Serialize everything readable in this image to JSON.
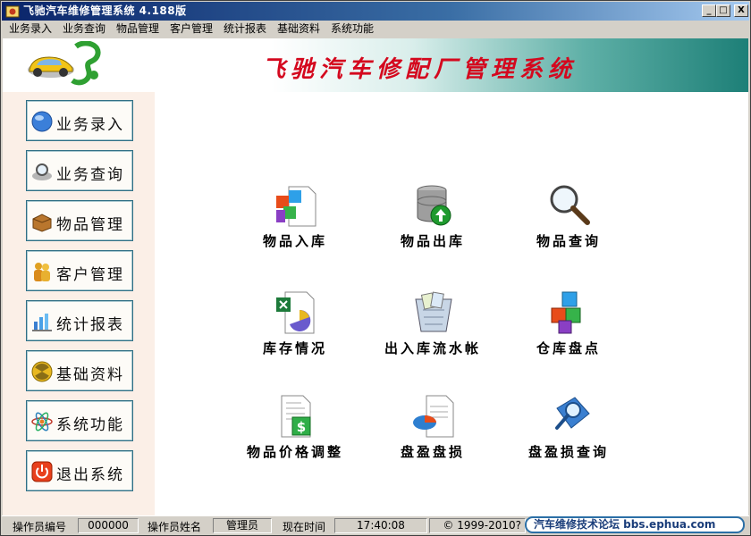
{
  "window": {
    "title": "飞驰汽车维修管理系统 4.188版",
    "controls": {
      "minimize": "_",
      "maximize": "□",
      "close": "X"
    }
  },
  "menu": [
    "业务录入",
    "业务查询",
    "物品管理",
    "客户管理",
    "统计报表",
    "基础资料",
    "系统功能"
  ],
  "banner": {
    "title": "飞驰汽车修配厂管理系统",
    "logo_icon": "car-logo"
  },
  "sidebar": [
    {
      "label": "业务录入",
      "icon": "globe-icon"
    },
    {
      "label": "业务查询",
      "icon": "magnifier-icon"
    },
    {
      "label": "物品管理",
      "icon": "box-icon"
    },
    {
      "label": "客户管理",
      "icon": "people-icon"
    },
    {
      "label": "统计报表",
      "icon": "bar-chart-icon"
    },
    {
      "label": "基础资料",
      "icon": "radiation-icon"
    },
    {
      "label": "系统功能",
      "icon": "atom-icon"
    },
    {
      "label": "退出系统",
      "icon": "power-icon"
    }
  ],
  "tiles": [
    {
      "label": "物品入库",
      "icon": "cubes-document-icon"
    },
    {
      "label": "物品出库",
      "icon": "database-upload-icon"
    },
    {
      "label": "物品查询",
      "icon": "magnifier-icon"
    },
    {
      "label": "库存情况",
      "icon": "excel-chart-icon"
    },
    {
      "label": "出入库流水帐",
      "icon": "recycle-bin-icon"
    },
    {
      "label": "仓库盘点",
      "icon": "cubes-icon"
    },
    {
      "label": "物品价格调整",
      "icon": "price-document-icon"
    },
    {
      "label": "盘盈盘损",
      "icon": "pie-document-icon"
    },
    {
      "label": "盘盈损查询",
      "icon": "search-document-icon"
    }
  ],
  "status": {
    "operator_id_label": "操作员编号",
    "operator_id": "000000",
    "operator_name_label": "操作员姓名",
    "operator_name": "管理员",
    "time_label": "现在时间",
    "time": "17:40:08",
    "copyright": "© 1999-2010?",
    "forum": "汽车维修技术论坛 bbs.ephua.com"
  },
  "colors": {
    "banner_title": "#d4081e",
    "titlebar": "#0a246a",
    "sidebar_bg": "#fbefe7",
    "button_border": "#2f6f85"
  }
}
